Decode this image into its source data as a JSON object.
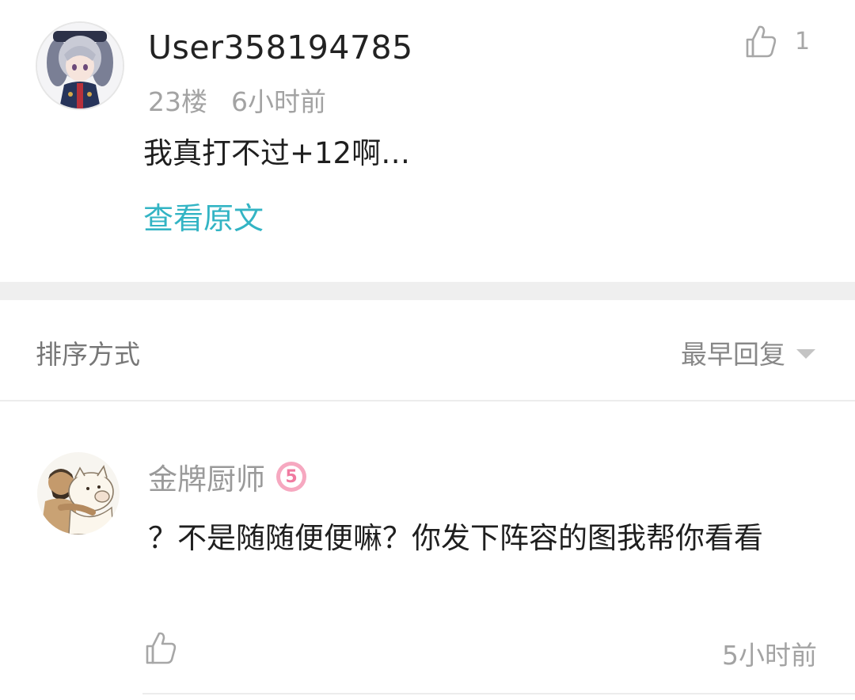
{
  "post": {
    "username": "User358194785",
    "floor": "23楼",
    "time": "6小时前",
    "like_count": "1",
    "content": "我真打不过+12啊…",
    "view_original": "查看原文"
  },
  "sort": {
    "label": "排序方式",
    "selected": "最早回复"
  },
  "reply": {
    "username": "金牌厨师",
    "level": "5",
    "content": "？不是随随便便嘛？你发下阵容的图我帮你看看",
    "time": "5小时前"
  },
  "colors": {
    "accent": "#33b4c4",
    "level_badge": "#f6a8c0",
    "divider": "#efefef"
  },
  "icons": {
    "like": "thumbs-up-icon",
    "sort_caret": "caret-down-icon"
  }
}
